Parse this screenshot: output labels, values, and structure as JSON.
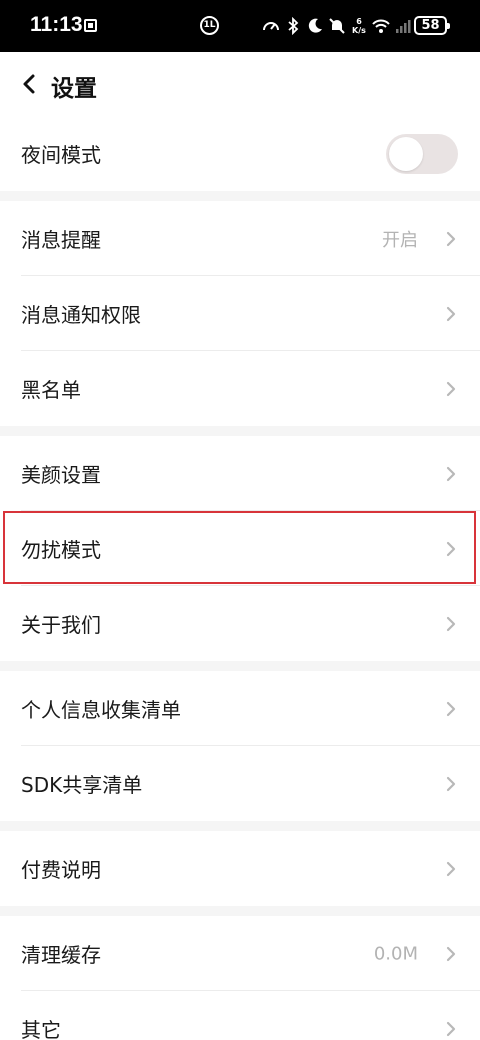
{
  "status_bar": {
    "time": "11:13",
    "notif_badge": "1L",
    "net_speed_value": "6",
    "net_speed_unit": "K/s",
    "battery": "58"
  },
  "header": {
    "title": "设置",
    "back_icon": "chevron-left-icon"
  },
  "settings": {
    "night_mode": {
      "label": "夜间模式",
      "enabled": false
    },
    "message_reminder": {
      "label": "消息提醒",
      "value": "开启"
    },
    "notification_permission": {
      "label": "消息通知权限"
    },
    "blacklist": {
      "label": "黑名单"
    },
    "beauty_settings": {
      "label": "美颜设置"
    },
    "do_not_disturb": {
      "label": "勿扰模式"
    },
    "about_us": {
      "label": "关于我们"
    },
    "personal_info_list": {
      "label": "个人信息收集清单"
    },
    "sdk_share_list": {
      "label": "SDK共享清单"
    },
    "payment_info": {
      "label": "付费说明"
    },
    "clear_cache": {
      "label": "清理缓存",
      "value": "0.0M"
    },
    "other": {
      "label": "其它"
    }
  },
  "colors": {
    "highlight": "#d8343a",
    "section_gap": "#f5f5f5",
    "toggle_off": "#e9e3e3"
  }
}
